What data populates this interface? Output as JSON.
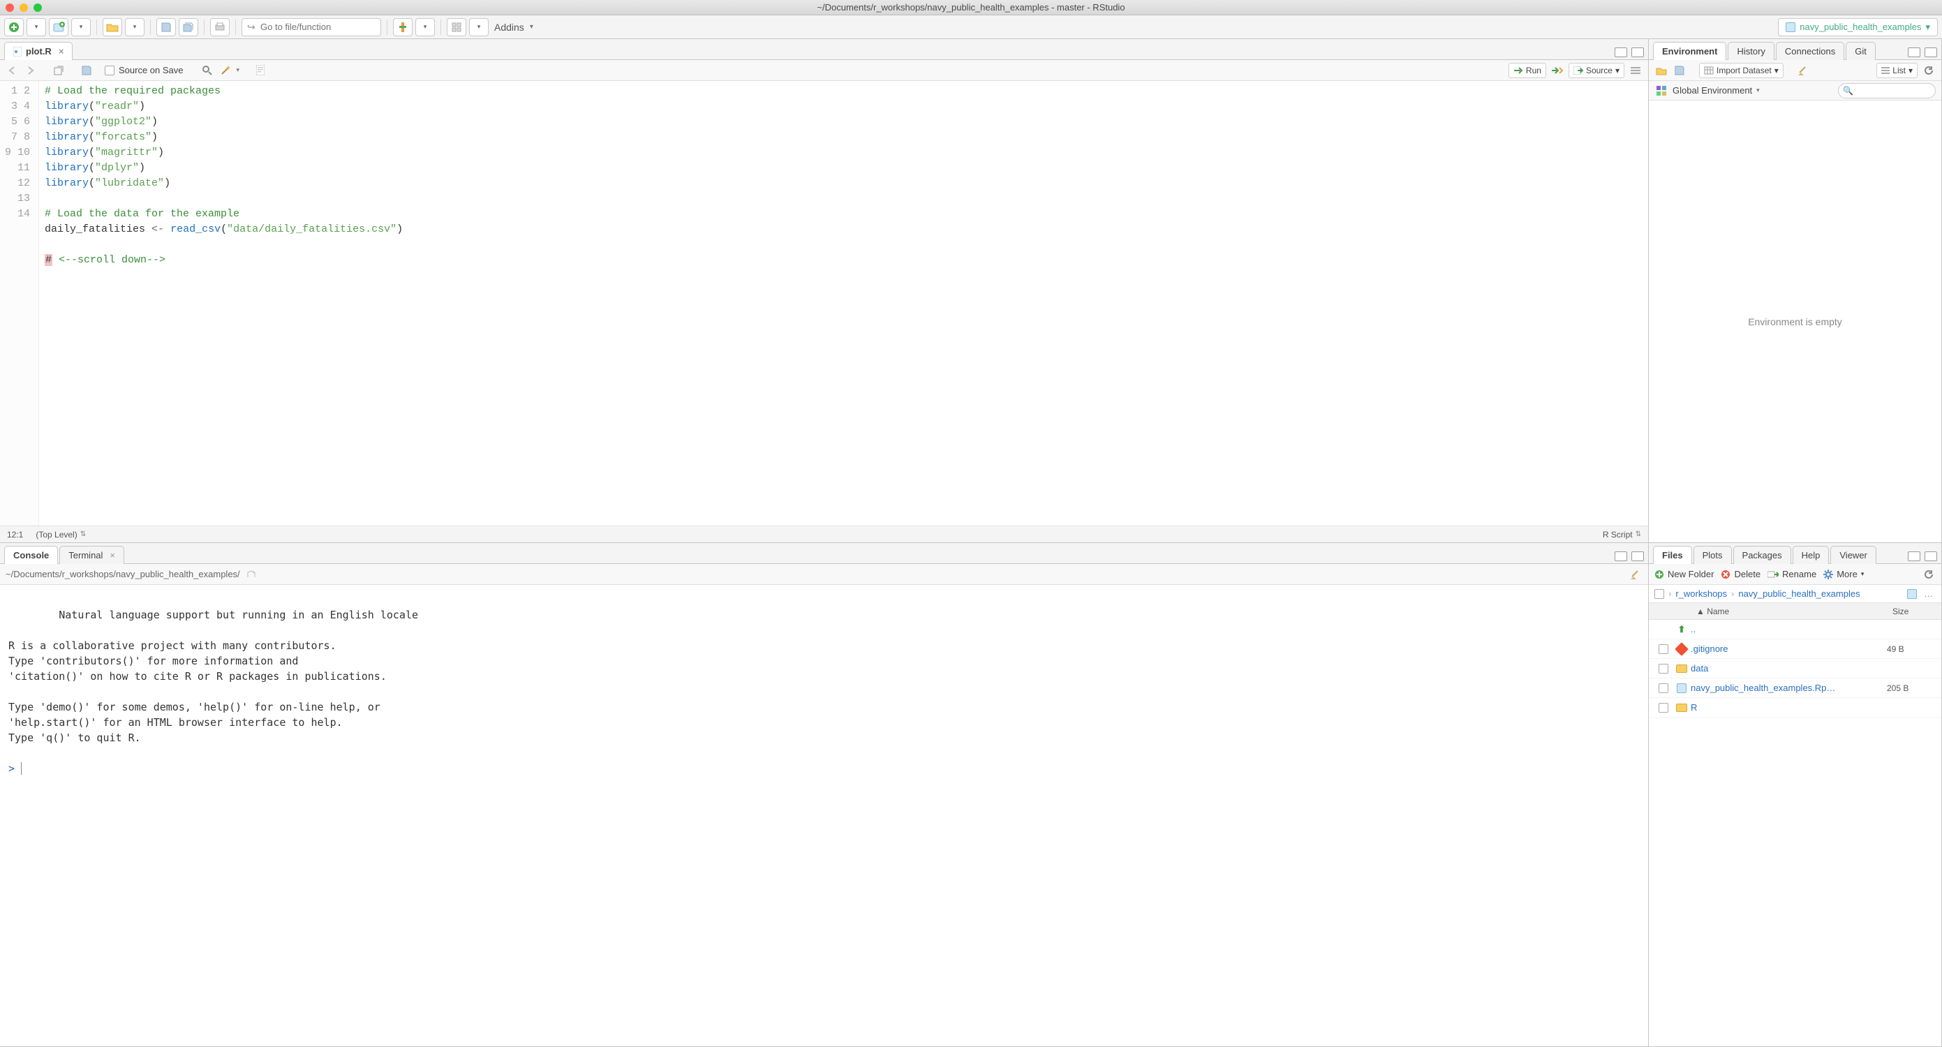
{
  "window": {
    "title": "~/Documents/r_workshops/navy_public_health_examples - master - RStudio"
  },
  "main_toolbar": {
    "goto_placeholder": "Go to file/function",
    "addins_label": "Addins",
    "project_name": "navy_public_health_examples"
  },
  "source_pane": {
    "tab_label": "plot.R",
    "source_on_save_label": "Source on Save",
    "run_label": "Run",
    "source_label": "Source",
    "status_pos": "12:1",
    "status_scope": "(Top Level)",
    "status_lang": "R Script",
    "code_lines": [
      {
        "n": 1,
        "text": "# Load the required packages",
        "type": "comment"
      },
      {
        "n": 2,
        "text": "library(\"readr\")",
        "type": "lib",
        "str": "\"readr\""
      },
      {
        "n": 3,
        "text": "library(\"ggplot2\")",
        "type": "lib",
        "str": "\"ggplot2\""
      },
      {
        "n": 4,
        "text": "library(\"forcats\")",
        "type": "lib",
        "str": "\"forcats\""
      },
      {
        "n": 5,
        "text": "library(\"magrittr\")",
        "type": "lib",
        "str": "\"magrittr\""
      },
      {
        "n": 6,
        "text": "library(\"dplyr\")",
        "type": "lib",
        "str": "\"dplyr\""
      },
      {
        "n": 7,
        "text": "library(\"lubridate\")",
        "type": "lib",
        "str": "\"lubridate\""
      },
      {
        "n": 8,
        "text": "",
        "type": "blank"
      },
      {
        "n": 9,
        "text": "# Load the data for the example",
        "type": "comment"
      },
      {
        "n": 10,
        "text": "daily_fatalities <- read_csv(\"data/daily_fatalities.csv\")",
        "type": "assign",
        "func": "read_csv",
        "str": "\"data/daily_fatalities.csv\"",
        "lhs": "daily_fatalities"
      },
      {
        "n": 11,
        "text": "",
        "type": "blank"
      },
      {
        "n": 12,
        "text": "# <--scroll down-->",
        "type": "cursorcomment"
      },
      {
        "n": 13,
        "text": "",
        "type": "blank"
      },
      {
        "n": 14,
        "text": "",
        "type": "blank"
      }
    ]
  },
  "console_pane": {
    "tab_console": "Console",
    "tab_terminal": "Terminal",
    "cwd": "~/Documents/r_workshops/navy_public_health_examples/",
    "body": "  Natural language support but running in an English locale\n\nR is a collaborative project with many contributors.\nType 'contributors()' for more information and\n'citation()' on how to cite R or R packages in publications.\n\nType 'demo()' for some demos, 'help()' for on-line help, or\n'help.start()' for an HTML browser interface to help.\nType 'q()' to quit R.\n",
    "prompt": ">"
  },
  "env_pane": {
    "tabs": [
      "Environment",
      "History",
      "Connections",
      "Git"
    ],
    "import_label": "Import Dataset",
    "scope_label": "Global Environment",
    "list_label": "List",
    "empty_text": "Environment is empty"
  },
  "files_pane": {
    "tabs": [
      "Files",
      "Plots",
      "Packages",
      "Help",
      "Viewer"
    ],
    "actions": {
      "new_folder": "New Folder",
      "delete": "Delete",
      "rename": "Rename",
      "more": "More"
    },
    "breadcrumb": [
      "r_workshops",
      "navy_public_health_examples"
    ],
    "header_name": "Name",
    "header_size": "Size",
    "rows": [
      {
        "name": "..",
        "icon": "up",
        "size": ""
      },
      {
        "name": ".gitignore",
        "icon": "git",
        "size": "49 B"
      },
      {
        "name": "data",
        "icon": "folder",
        "size": ""
      },
      {
        "name": "navy_public_health_examples.Rp…",
        "icon": "rproj",
        "size": "205 B"
      },
      {
        "name": "R",
        "icon": "folder",
        "size": ""
      }
    ]
  }
}
